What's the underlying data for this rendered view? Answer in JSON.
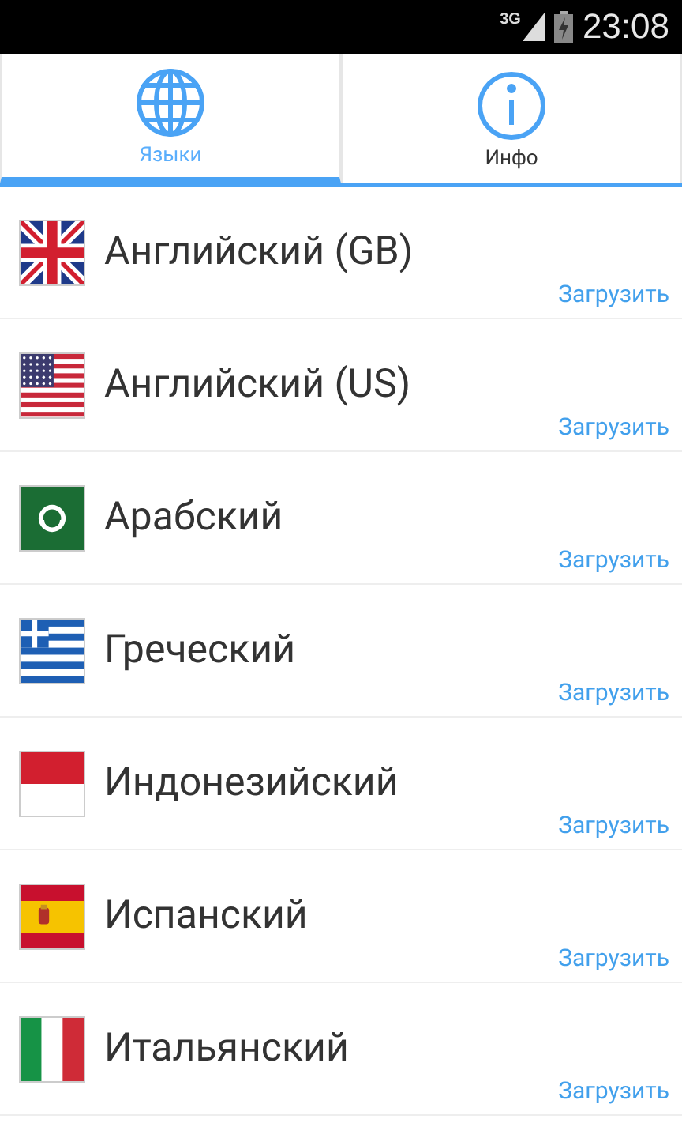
{
  "status_bar": {
    "network": "3G",
    "time": "23:08"
  },
  "tabs": [
    {
      "label": "Языки",
      "selected": true
    },
    {
      "label": "Инфо",
      "selected": false
    }
  ],
  "languages": [
    {
      "name": "Английский (GB)",
      "action": "Загрузить"
    },
    {
      "name": "Английский (US)",
      "action": "Загрузить"
    },
    {
      "name": "Арабский",
      "action": "Загрузить"
    },
    {
      "name": "Греческий",
      "action": "Загрузить"
    },
    {
      "name": "Индонезийский",
      "action": "Загрузить"
    },
    {
      "name": "Испанский",
      "action": "Загрузить"
    },
    {
      "name": "Итальянский",
      "action": "Загрузить"
    }
  ]
}
